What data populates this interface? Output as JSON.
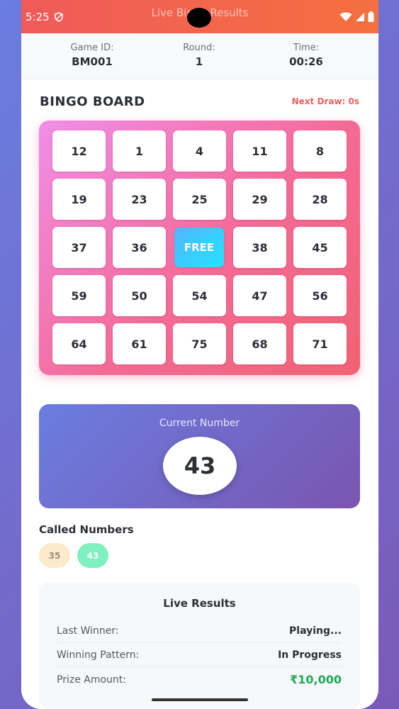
{
  "status_bar": {
    "time": "5:25",
    "title": "Live Bingo Results",
    "icons": [
      "shield-icon",
      "wifi-icon",
      "signal-icon",
      "battery-icon"
    ],
    "gradient": [
      "#f05a5a",
      "#f4703f"
    ]
  },
  "game_info": {
    "game_id_label": "Game ID:",
    "game_id": "BM001",
    "round_label": "Round:",
    "round": "1",
    "time_label": "Time:",
    "time": "00:26"
  },
  "board": {
    "title": "BINGO BOARD",
    "next_draw": "Next Draw: 0s",
    "rows": [
      [
        "12",
        "1",
        "4",
        "11",
        "8"
      ],
      [
        "19",
        "23",
        "25",
        "29",
        "28"
      ],
      [
        "37",
        "36",
        "FREE",
        "38",
        "45"
      ],
      [
        "59",
        "50",
        "54",
        "47",
        "56"
      ],
      [
        "64",
        "61",
        "75",
        "68",
        "71"
      ]
    ]
  },
  "current": {
    "label": "Current Number",
    "number": "43"
  },
  "called": {
    "title": "Called Numbers",
    "numbers": [
      {
        "value": "35",
        "bg": "#fde9cc",
        "color": "#9a8c76"
      },
      {
        "value": "43",
        "bg": "#7ff0c0",
        "color": "#ffffff"
      }
    ]
  },
  "results": {
    "title": "Live Results",
    "rows": [
      {
        "label": "Last Winner:",
        "value": "Playing..."
      },
      {
        "label": "Winning Pattern:",
        "value": "In Progress"
      },
      {
        "label": "Prize Amount:",
        "value": "₹10,000"
      }
    ],
    "prize_color": "#21a858"
  }
}
